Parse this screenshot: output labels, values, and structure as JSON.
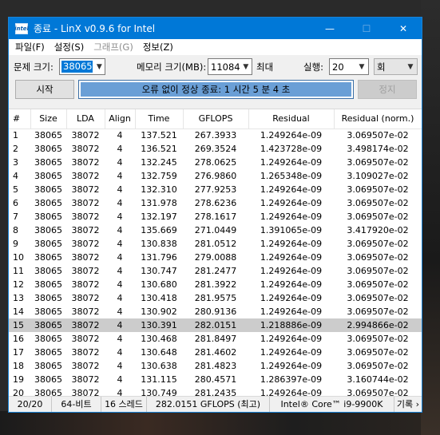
{
  "window": {
    "title": "종료 - LinX v0.9.6 for Intel",
    "icon": "intel-icon",
    "icon_text": "intel",
    "minimize": "—",
    "maximize": "☐",
    "close": "✕"
  },
  "menu": [
    "파일(F)",
    "설정(S)",
    "그래프(G)",
    "정보(Z)"
  ],
  "controls": {
    "problem_size_label": "문제 크기:",
    "problem_size_value": "38065",
    "memory_label": "메모리 크기(MB):",
    "memory_value": "11084",
    "max_label": "최대",
    "run_label": "실행:",
    "run_value": "20",
    "unit_value": "회"
  },
  "actions": {
    "start_label": "시작",
    "status_text": "오류 없이 정상 종료: 1 시간 5 분 4 초",
    "stop_label": "정지"
  },
  "table": {
    "columns": [
      "#",
      "Size",
      "LDA",
      "Align",
      "Time",
      "GFLOPS",
      "Residual",
      "Residual (norm.)"
    ],
    "rows": [
      [
        "1",
        "38065",
        "38072",
        "4",
        "137.521",
        "267.3933",
        "1.249264e-09",
        "3.069507e-02"
      ],
      [
        "2",
        "38065",
        "38072",
        "4",
        "136.521",
        "269.3524",
        "1.423728e-09",
        "3.498174e-02"
      ],
      [
        "3",
        "38065",
        "38072",
        "4",
        "132.245",
        "278.0625",
        "1.249264e-09",
        "3.069507e-02"
      ],
      [
        "4",
        "38065",
        "38072",
        "4",
        "132.759",
        "276.9860",
        "1.265348e-09",
        "3.109027e-02"
      ],
      [
        "5",
        "38065",
        "38072",
        "4",
        "132.310",
        "277.9253",
        "1.249264e-09",
        "3.069507e-02"
      ],
      [
        "6",
        "38065",
        "38072",
        "4",
        "131.978",
        "278.6236",
        "1.249264e-09",
        "3.069507e-02"
      ],
      [
        "7",
        "38065",
        "38072",
        "4",
        "132.197",
        "278.1617",
        "1.249264e-09",
        "3.069507e-02"
      ],
      [
        "8",
        "38065",
        "38072",
        "4",
        "135.669",
        "271.0449",
        "1.391065e-09",
        "3.417920e-02"
      ],
      [
        "9",
        "38065",
        "38072",
        "4",
        "130.838",
        "281.0512",
        "1.249264e-09",
        "3.069507e-02"
      ],
      [
        "10",
        "38065",
        "38072",
        "4",
        "131.796",
        "279.0088",
        "1.249264e-09",
        "3.069507e-02"
      ],
      [
        "11",
        "38065",
        "38072",
        "4",
        "130.747",
        "281.2477",
        "1.249264e-09",
        "3.069507e-02"
      ],
      [
        "12",
        "38065",
        "38072",
        "4",
        "130.680",
        "281.3922",
        "1.249264e-09",
        "3.069507e-02"
      ],
      [
        "13",
        "38065",
        "38072",
        "4",
        "130.418",
        "281.9575",
        "1.249264e-09",
        "3.069507e-02"
      ],
      [
        "14",
        "38065",
        "38072",
        "4",
        "130.902",
        "280.9136",
        "1.249264e-09",
        "3.069507e-02"
      ],
      [
        "15",
        "38065",
        "38072",
        "4",
        "130.391",
        "282.0151",
        "1.218886e-09",
        "2.994866e-02"
      ],
      [
        "16",
        "38065",
        "38072",
        "4",
        "130.468",
        "281.8497",
        "1.249264e-09",
        "3.069507e-02"
      ],
      [
        "17",
        "38065",
        "38072",
        "4",
        "130.648",
        "281.4602",
        "1.249264e-09",
        "3.069507e-02"
      ],
      [
        "18",
        "38065",
        "38072",
        "4",
        "130.638",
        "281.4823",
        "1.249264e-09",
        "3.069507e-02"
      ],
      [
        "19",
        "38065",
        "38072",
        "4",
        "131.115",
        "280.4571",
        "1.286397e-09",
        "3.160744e-02"
      ],
      [
        "20",
        "38065",
        "38072",
        "4",
        "130.749",
        "281.2435",
        "1.249264e-09",
        "3.069507e-02"
      ]
    ],
    "selected_row": "15"
  },
  "statusbar": {
    "runs": "20/20",
    "bits": "64-비트",
    "threads": "16 스레드",
    "best": "282.0151 GFLOPS (최고)",
    "cpu": "Intel® Core™ i9-9900K",
    "log": "기록 ›"
  },
  "colors": {
    "titlebar": "#0078d7",
    "status_fill": "#6a9fd6",
    "selected_row": "#cccccc"
  }
}
